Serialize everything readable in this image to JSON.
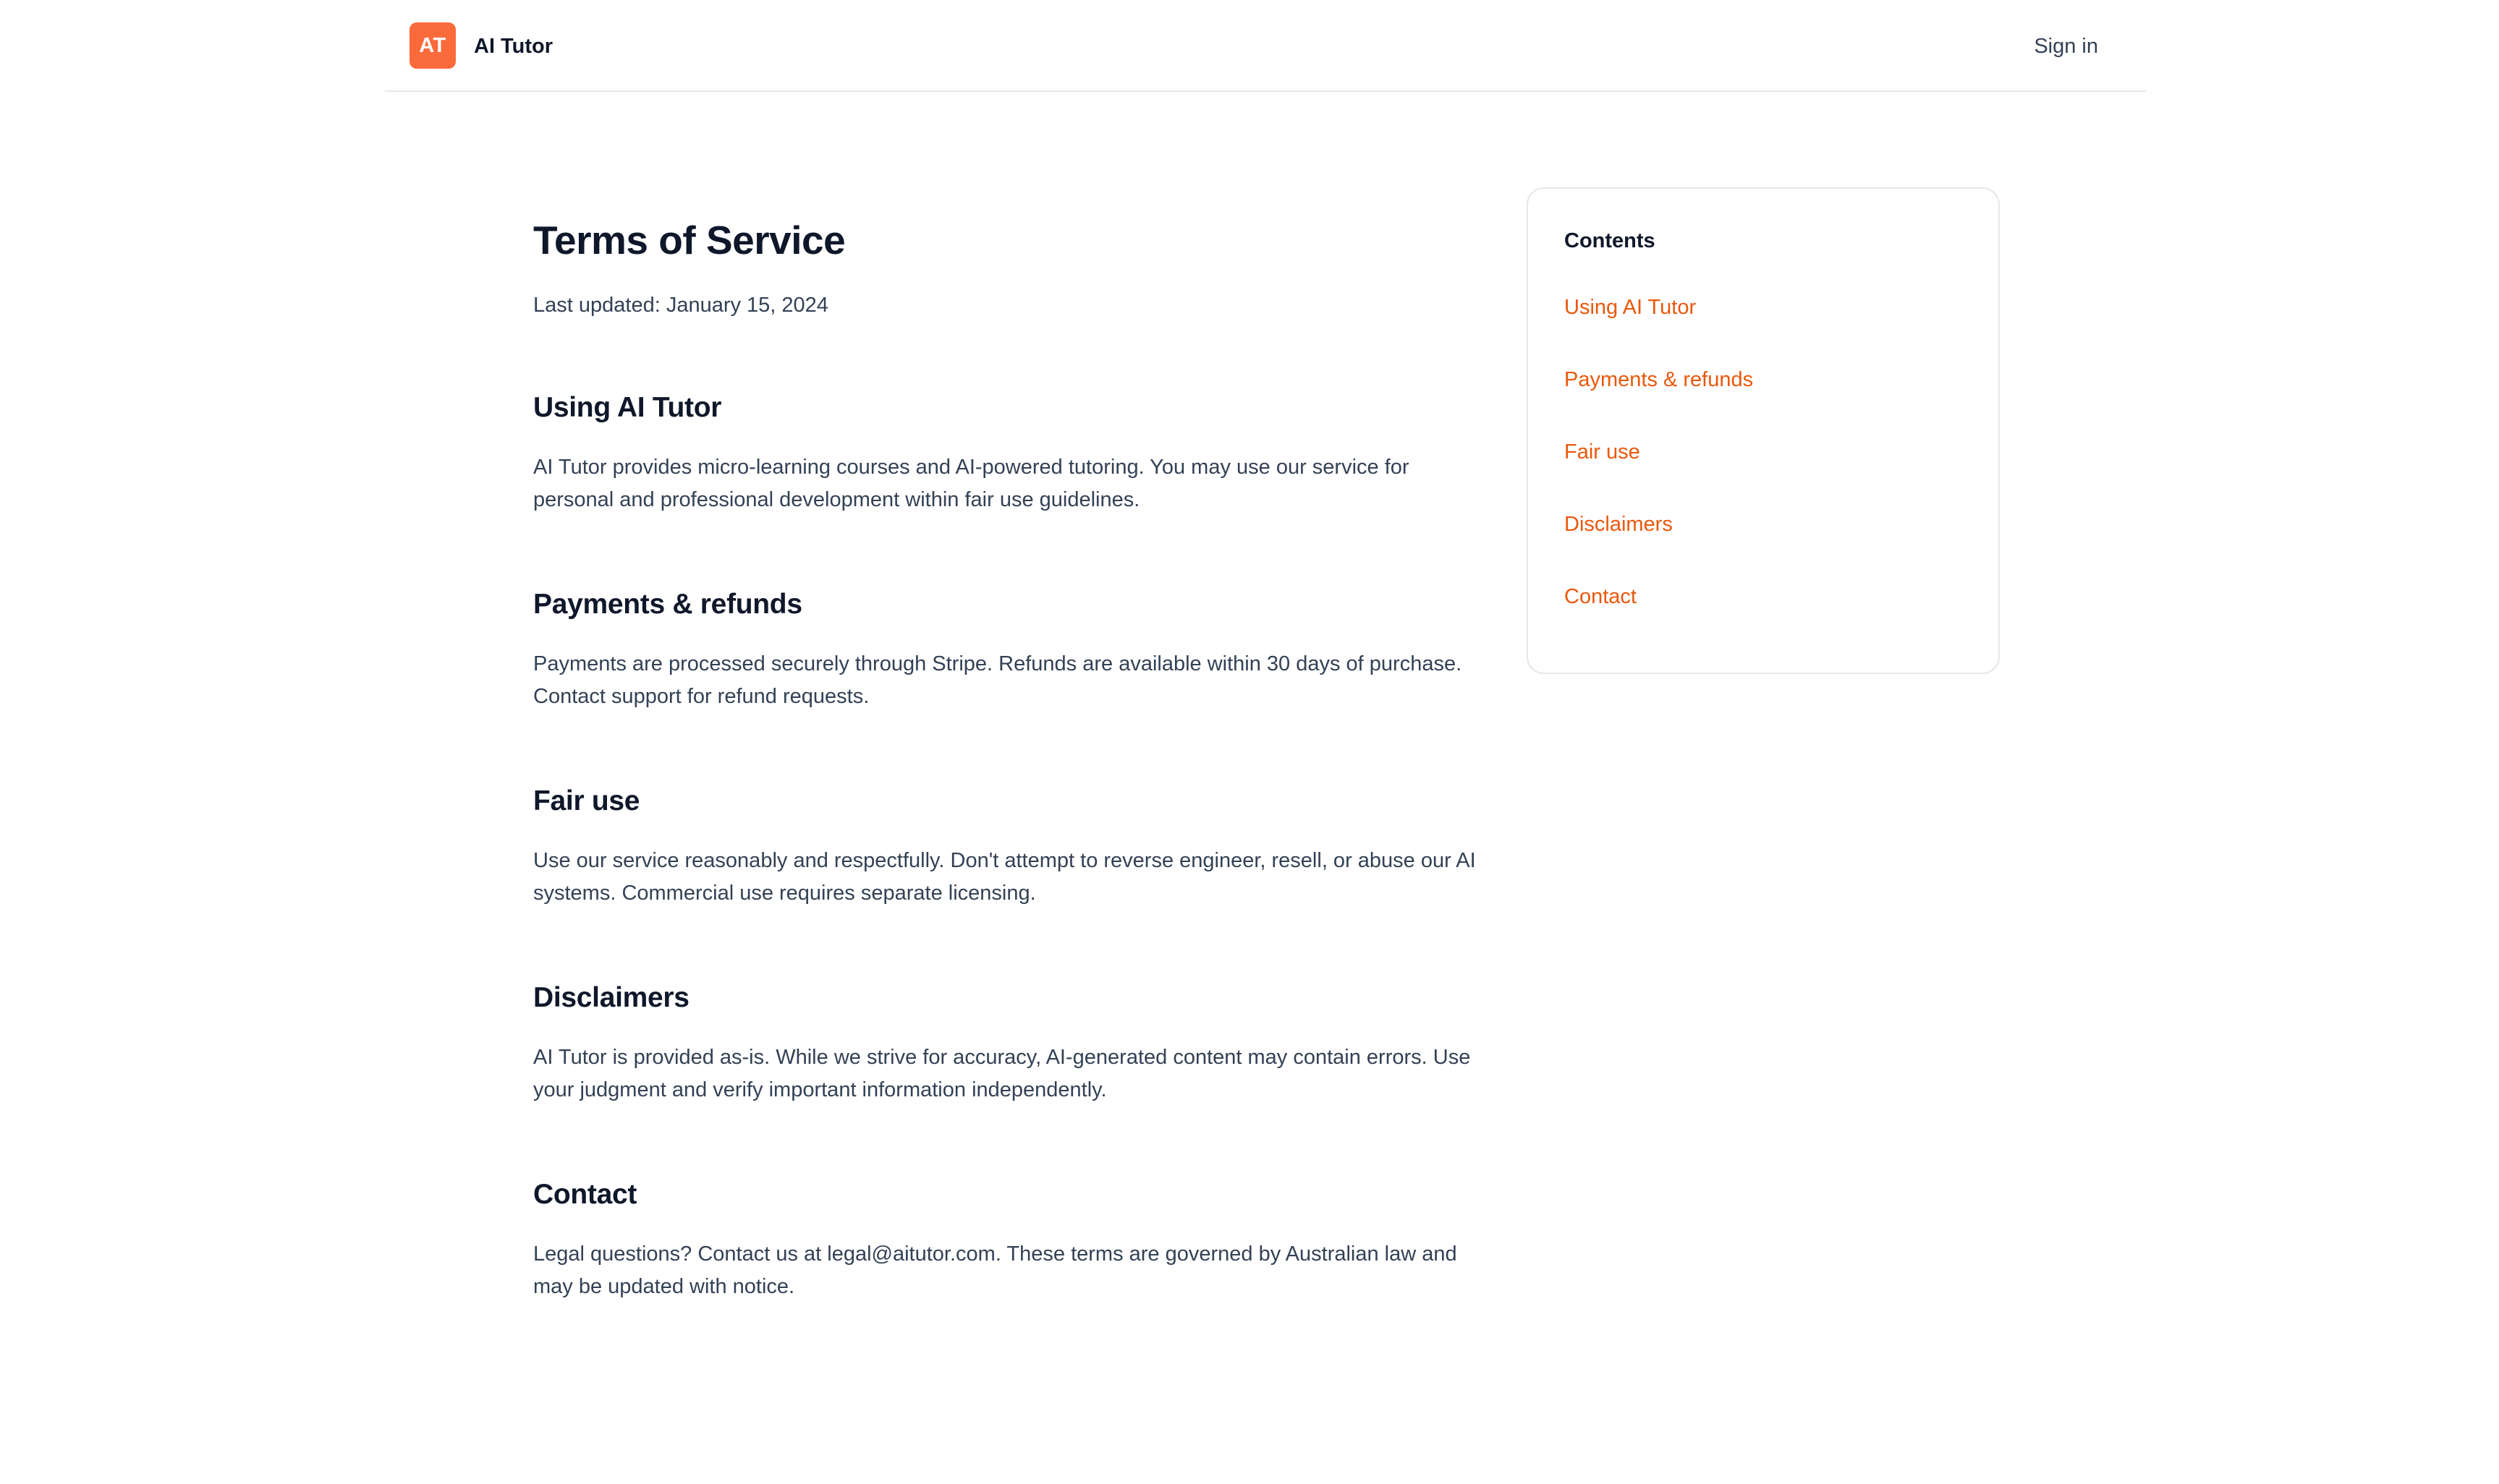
{
  "header": {
    "logo_text": "AT",
    "brand_name": "AI Tutor",
    "signin_label": "Sign in",
    "accent_color": "#fa6a3a"
  },
  "article": {
    "title": "Terms of Service",
    "last_updated": "Last updated: January 15, 2024",
    "sections": [
      {
        "heading": "Using AI Tutor",
        "body": "AI Tutor provides micro-learning courses and AI-powered tutoring. You may use our service for personal and professional development within fair use guidelines."
      },
      {
        "heading": "Payments & refunds",
        "body": "Payments are processed securely through Stripe. Refunds are available within 30 days of purchase. Contact support for refund requests."
      },
      {
        "heading": "Fair use",
        "body": "Use our service reasonably and respectfully. Don't attempt to reverse engineer, resell, or abuse our AI systems. Commercial use requires separate licensing."
      },
      {
        "heading": "Disclaimers",
        "body": "AI Tutor is provided as-is. While we strive for accuracy, AI-generated content may contain errors. Use your judgment and verify important information independently."
      },
      {
        "heading": "Contact",
        "body": "Legal questions? Contact us at legal@aitutor.com. These terms are governed by Australian law and may be updated with notice."
      }
    ]
  },
  "toc": {
    "title": "Contents",
    "items": [
      "Using AI Tutor",
      "Payments & refunds",
      "Fair use",
      "Disclaimers",
      "Contact"
    ],
    "link_color": "#ea580c"
  }
}
